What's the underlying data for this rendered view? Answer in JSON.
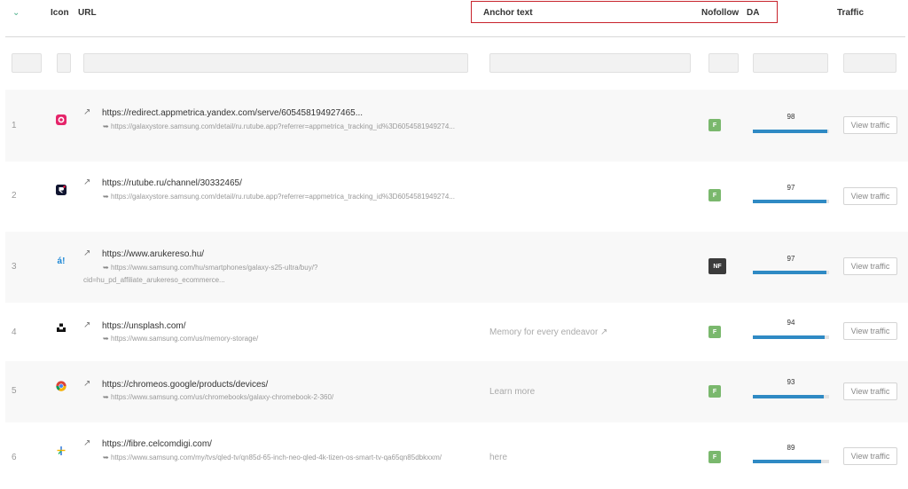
{
  "header": {
    "caret_label": "⌄",
    "icon_label": "Icon",
    "url_label": "URL",
    "anchor_label": "Anchor text",
    "nofollow_label": "Nofollow",
    "da_label": "DA",
    "traffic_label": "Traffic"
  },
  "colors": {
    "highlight_box": "#c8232c",
    "follow_badge": "#7ab86d",
    "nofollow_badge": "#3b3b3b",
    "da_bar": "#2f8ac4"
  },
  "rows": [
    {
      "index": "1",
      "icon": "circle-app-icon",
      "url": "https://redirect.appmetrica.yandex.com/serve/605458194927465...",
      "redirect": "https://galaxystore.samsung.com/detail/ru.rutube.app?referrer=appmetrica_tracking_id%3D6054581949274...",
      "anchor": "",
      "nofollow": "F",
      "da": "98",
      "da_fraction": 0.98,
      "traffic_button": "View traffic"
    },
    {
      "index": "2",
      "icon": "rutube-logo-icon",
      "url": "https://rutube.ru/channel/30332465/",
      "redirect": "https://galaxystore.samsung.com/detail/ru.rutube.app?referrer=appmetrica_tracking_id%3D6054581949274...",
      "anchor": "",
      "nofollow": "F",
      "da": "97",
      "da_fraction": 0.97,
      "traffic_button": "View traffic"
    },
    {
      "index": "3",
      "icon": "arukereso-logo-icon",
      "url": "https://www.arukereso.hu/",
      "redirect": "https://www.samsung.com/hu/smartphones/galaxy-s25-ultra/buy/?cid=hu_pd_affiliate_arukereso_ecommerce...",
      "anchor": "",
      "nofollow": "NF",
      "da": "97",
      "da_fraction": 0.97,
      "traffic_button": "View traffic"
    },
    {
      "index": "4",
      "icon": "unsplash-logo-icon",
      "url": "https://unsplash.com/",
      "redirect": "https://www.samsung.com/us/memory-storage/",
      "anchor": "Memory for every endeavor ↗",
      "nofollow": "F",
      "da": "94",
      "da_fraction": 0.94,
      "traffic_button": "View traffic"
    },
    {
      "index": "5",
      "icon": "chrome-logo-icon",
      "url": "https://chromeos.google/products/devices/",
      "redirect": "https://www.samsung.com/us/chromebooks/galaxy-chromebook-2-360/",
      "anchor": "Learn more",
      "nofollow": "F",
      "da": "93",
      "da_fraction": 0.93,
      "traffic_button": "View traffic"
    },
    {
      "index": "6",
      "icon": "celcomdigi-logo-icon",
      "url": "https://fibre.celcomdigi.com/",
      "redirect": "https://www.samsung.com/my/tvs/qled-tv/qn85d-65-inch-neo-qled-4k-tizen-os-smart-tv-qa65qn85dbkxxm/",
      "anchor": "here",
      "nofollow": "F",
      "da": "89",
      "da_fraction": 0.89,
      "traffic_button": "View traffic"
    }
  ]
}
